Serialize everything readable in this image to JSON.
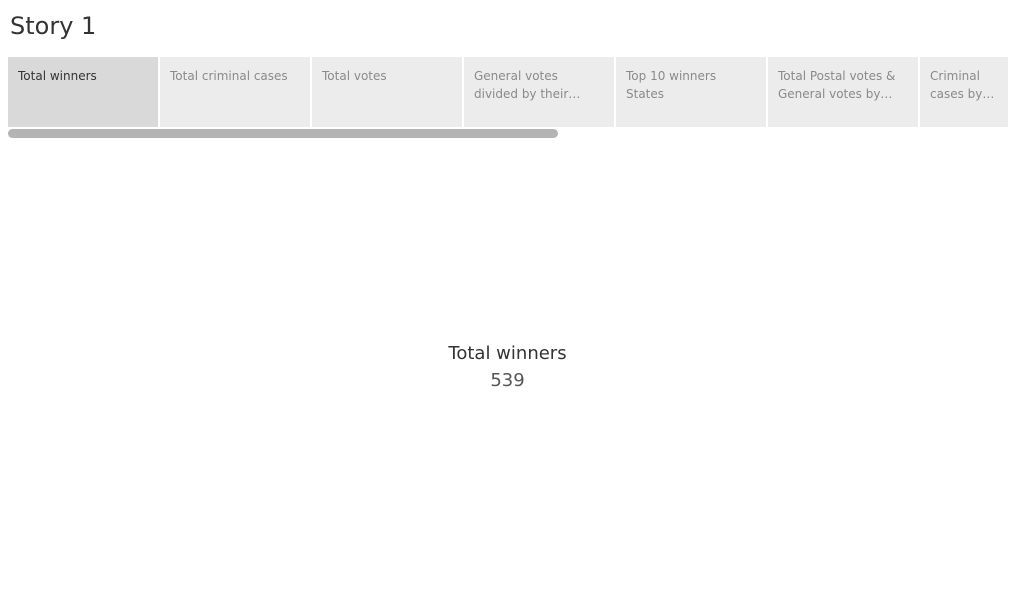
{
  "story": {
    "title": "Story 1"
  },
  "nav": {
    "points": [
      {
        "label": "Total winners",
        "active": true
      },
      {
        "label": "Total criminal cases",
        "active": false
      },
      {
        "label": "Total votes",
        "active": false
      },
      {
        "label": "General votes divided by their Education Qu..",
        "active": false
      },
      {
        "label": "Top 10 winners States",
        "active": false
      },
      {
        "label": "Total Postal votes & General votes by stat..",
        "active": false
      },
      {
        "label": "Criminal cases by sta..",
        "active": false
      }
    ]
  },
  "kpi": {
    "label": "Total winners",
    "value": "539"
  }
}
